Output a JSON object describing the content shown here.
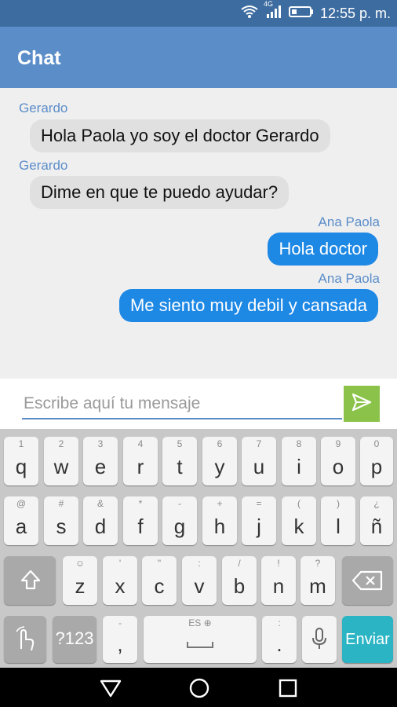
{
  "status_bar": {
    "time": "12:55 p. m.",
    "network": "4G"
  },
  "app_bar": {
    "title": "Chat"
  },
  "messages": [
    {
      "sender": "Gerardo",
      "text": "Hola Paola yo soy el doctor Gerardo",
      "direction": "in"
    },
    {
      "sender": "Gerardo",
      "text": "Dime en que te puedo ayudar?",
      "direction": "in"
    },
    {
      "sender": "Ana Paola",
      "text": "Hola doctor",
      "direction": "out"
    },
    {
      "sender": "Ana Paola",
      "text": "Me siento muy debil y cansada",
      "direction": "out"
    }
  ],
  "composer": {
    "placeholder": "Escribe aquí tu mensaje",
    "send_icon": "send-icon"
  },
  "keyboard": {
    "row1": [
      {
        "hint": "1",
        "letter": "q"
      },
      {
        "hint": "2",
        "letter": "w"
      },
      {
        "hint": "3",
        "letter": "e"
      },
      {
        "hint": "4",
        "letter": "r"
      },
      {
        "hint": "5",
        "letter": "t"
      },
      {
        "hint": "6",
        "letter": "y"
      },
      {
        "hint": "7",
        "letter": "u"
      },
      {
        "hint": "8",
        "letter": "i"
      },
      {
        "hint": "9",
        "letter": "o"
      },
      {
        "hint": "0",
        "letter": "p"
      }
    ],
    "row2": [
      {
        "hint": "@",
        "letter": "a"
      },
      {
        "hint": "#",
        "letter": "s"
      },
      {
        "hint": "&",
        "letter": "d"
      },
      {
        "hint": "*",
        "letter": "f"
      },
      {
        "hint": "-",
        "letter": "g"
      },
      {
        "hint": "+",
        "letter": "h"
      },
      {
        "hint": "=",
        "letter": "j"
      },
      {
        "hint": "(",
        "letter": "k"
      },
      {
        "hint": ")",
        "letter": "l"
      },
      {
        "hint": "¿",
        "letter": "ñ"
      }
    ],
    "row3": [
      {
        "hint": "☺",
        "letter": "z"
      },
      {
        "hint": "'",
        "letter": "x"
      },
      {
        "hint": "\"",
        "letter": "c"
      },
      {
        "hint": ":",
        "letter": "v"
      },
      {
        "hint": "/",
        "letter": "b"
      },
      {
        "hint": "!",
        "letter": "n"
      },
      {
        "hint": "?",
        "letter": "m"
      }
    ],
    "symbols_label": "?123",
    "comma": ",",
    "comma_hint": "-",
    "space_hint": "ES ⊕",
    "period": ".",
    "period_hint": ":",
    "enter_label": "Enviar"
  },
  "colors": {
    "status_bar": "#3d6ca0",
    "app_bar": "#5b8dc9",
    "outgoing_bubble": "#1e88e5",
    "send_button": "#8bc34a",
    "enter_key": "#2ab4c4"
  }
}
